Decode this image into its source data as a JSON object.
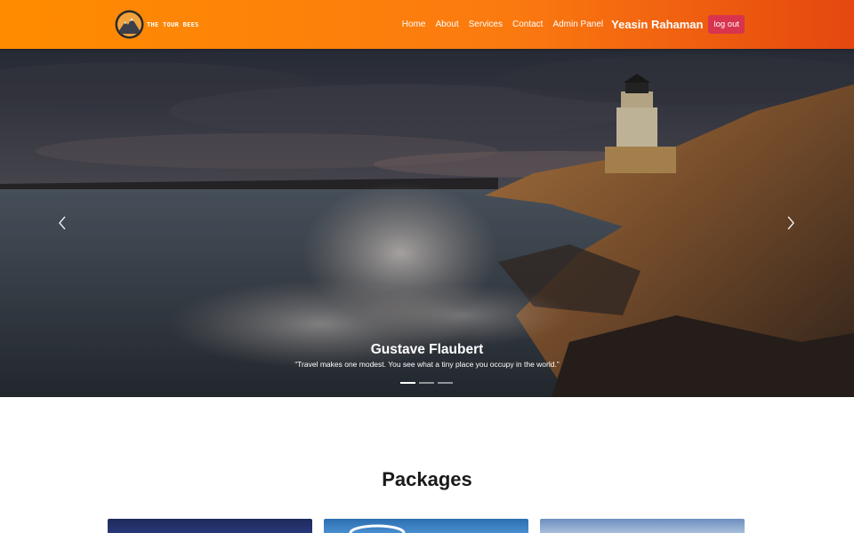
{
  "brand": {
    "name": "THE TOUR BEES",
    "logo_icon": "mountain-logo-icon"
  },
  "nav": {
    "links": [
      "Home",
      "About",
      "Services",
      "Contact",
      "Admin Panel"
    ],
    "user_name": "Yeasin Rahaman",
    "logout_label": "log out"
  },
  "colors": {
    "navbar_start": "#ff8c00",
    "navbar_end": "#e5470f",
    "logout_button": "#d8344f"
  },
  "hero": {
    "caption_title": "Gustave Flaubert",
    "caption_quote": "“Travel makes one modest. You see what a tiny place you occupy in the world.”",
    "prev_icon": "chevron-left-icon",
    "next_icon": "chevron-right-icon",
    "slide_count": 3,
    "active_slide": 1
  },
  "packages": {
    "title": "Packages",
    "card_count": 3
  }
}
